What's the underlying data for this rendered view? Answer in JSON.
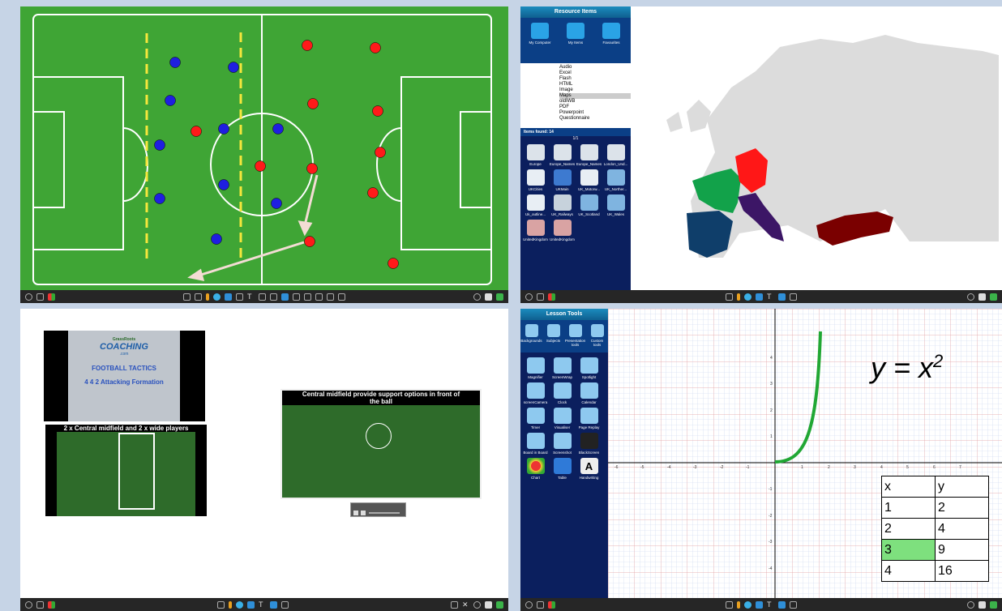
{
  "quadrants": {
    "q3": {
      "title_slide": {
        "logo_line1": "GrassRoots",
        "logo_line2": "COACHING",
        "logo_line3": ".com",
        "title": "FOOTBALL TACTICS",
        "subtitle": "4 4 2 Attacking Formation"
      },
      "pitch_caption": "2 x Central midfield and 2 x wide players",
      "video_caption": "Central midfield provide support options in front of the ball"
    },
    "q2": {
      "panel_title": "Resource Items",
      "sources": [
        "My Computer",
        "My Items",
        "Favourites"
      ],
      "folders": [
        "Audio",
        "Excel",
        "Flash",
        "HTML",
        "Image",
        "Maps",
        "oldIWB",
        "PDF",
        "Powerpoint",
        "Questionnaire"
      ],
      "items_found_label": "Items found: 14",
      "pager": "1/1",
      "items": [
        "Europe",
        "Europe_Names",
        "Europe_Names",
        "London_Und...",
        "UKCities",
        "UKMain",
        "UK_Motorw...",
        "UK_Norther...",
        "Uk_outline...",
        "UK_Railways",
        "UK_Scotland",
        "UK_Wales",
        "UnitedKingdom",
        "UnitedKingdom"
      ]
    },
    "q4": {
      "panel_title": "Lesson Tools",
      "categories": [
        "Backgrounds",
        "Subjects",
        "Presentation tools",
        "Custom tools"
      ],
      "tools": [
        "Magnifier",
        "ScreenWrap",
        "Spotlight",
        "screenCamera",
        "Clock",
        "Calendar",
        "Timer",
        "Visualiser",
        "Page Replay",
        "Board in Board",
        "Screenshot",
        "BlackScreen",
        "Chart",
        "Table",
        "Handwriting"
      ],
      "equation": "y = x",
      "equation_exp": "2",
      "table_header": [
        "x",
        "y"
      ],
      "table_rows": [
        [
          "1",
          "2"
        ],
        [
          "2",
          "4"
        ],
        [
          "3",
          "9"
        ],
        [
          "4",
          "16"
        ]
      ],
      "x_ticks": [
        "-6",
        "-5",
        "-4",
        "-3",
        "-2",
        "-1",
        "1",
        "2",
        "3",
        "4",
        "5",
        "6",
        "7"
      ],
      "y_ticks": [
        "4",
        "3",
        "2",
        "1",
        "-1",
        "-2",
        "-3",
        "-4"
      ]
    }
  },
  "colors": {
    "pitch": "#3fa535",
    "team_a": "#1f1fe0",
    "team_b": "#ff1a1a",
    "france": "#12a24a",
    "germany": "#ff1717",
    "italy": "#3c1666",
    "spain": "#0f3e6a",
    "turkey": "#7a0000",
    "curve": "#21a734"
  }
}
